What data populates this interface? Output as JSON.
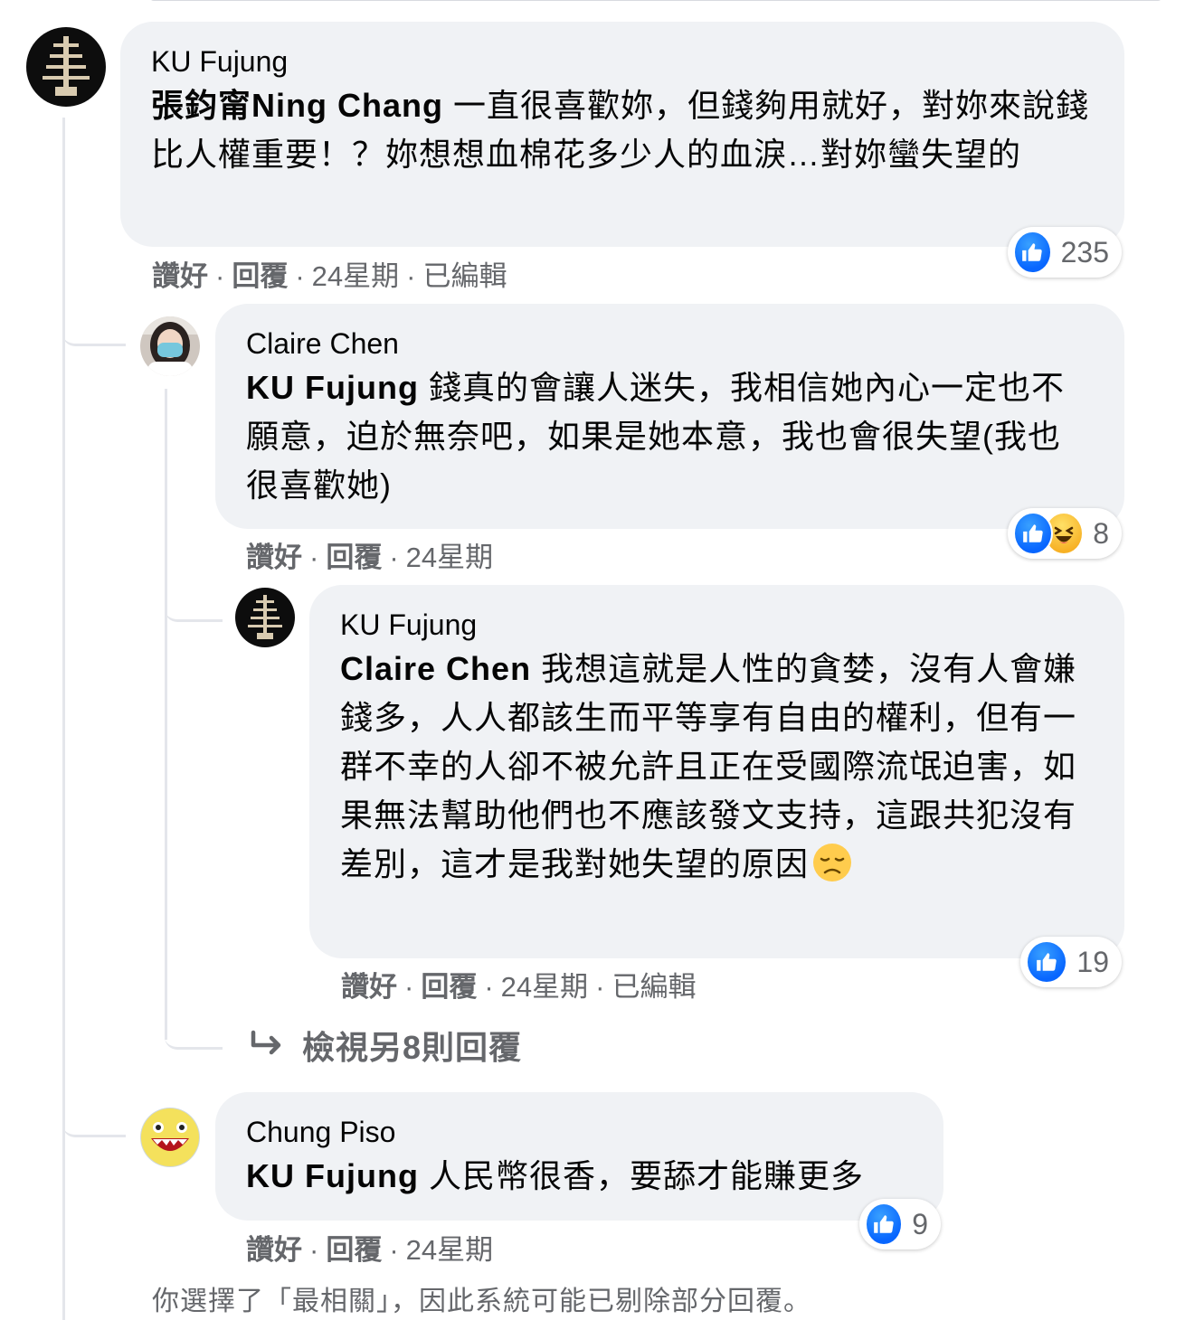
{
  "comments": [
    {
      "author": "KU Fujung",
      "mention": "張鈞甯Ning Chang",
      "text": " 一直很喜歡妳，但錢夠用就好，對妳來說錢比人權重要！？妳想想血棉花多少人的血淚…對妳蠻失望的",
      "like_label": "讚好",
      "reply_label": "回覆",
      "time": "24星期",
      "edited": "已編輯",
      "reaction_count": "235"
    },
    {
      "author": "Claire Chen",
      "mention": "KU Fujung",
      "text": " 錢真的會讓人迷失，我相信她內心一定也不願意，迫於無奈吧，如果是她本意，我也會很失望(我也很喜歡她)",
      "like_label": "讚好",
      "reply_label": "回覆",
      "time": "24星期",
      "reaction_count": "8"
    },
    {
      "author": "KU Fujung",
      "mention": "Claire Chen",
      "text": " 我想這就是人性的貪婪，沒有人會嫌錢多，人人都該生而平等享有自由的權利，但有一群不幸的人卻不被允許且正在受國際流氓迫害，如果無法幫助他們也不應該發文支持，這跟共犯沒有差別，這才是我對她失望的原因",
      "like_label": "讚好",
      "reply_label": "回覆",
      "time": "24星期",
      "edited": "已編輯",
      "reaction_count": "19"
    },
    {
      "author": "Chung Piso",
      "mention": "KU Fujung",
      "text": " 人民幣很香，要舔才能賺更多",
      "like_label": "讚好",
      "reply_label": "回覆",
      "time": "24星期",
      "reaction_count": "9"
    }
  ],
  "view_more_replies": "檢視另8則回覆",
  "filter_notice": "你選擇了「最相關」，因此系統可能已剔除部分回覆。",
  "colors": {
    "bubble": "#f0f2f5",
    "like_blue": "#0866ff",
    "secondary_text": "#65676b"
  },
  "icons": {
    "like": "thumbs-up-icon",
    "haha": "laughing-face-icon",
    "sad": "disappointed-face-icon",
    "reply_arrow": "reply-arrow-icon"
  }
}
